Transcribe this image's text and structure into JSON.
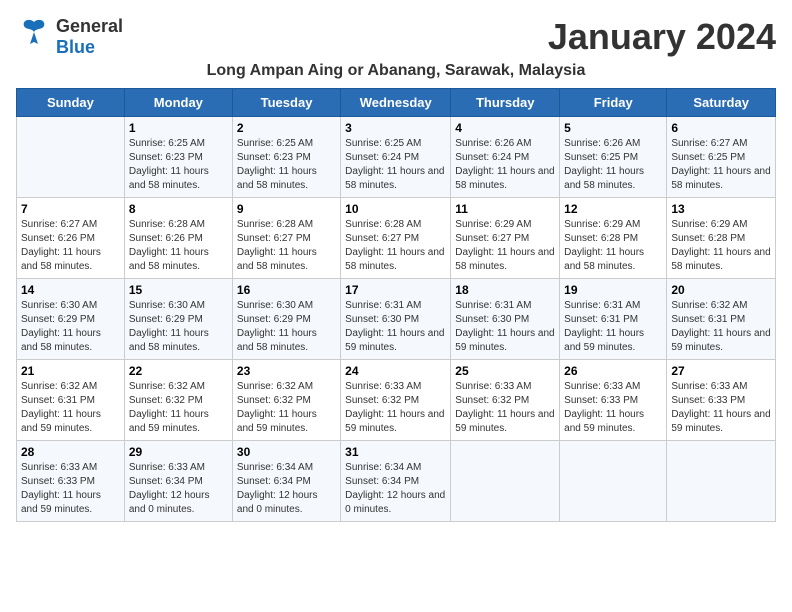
{
  "logo": {
    "general": "General",
    "blue": "Blue"
  },
  "title": "January 2024",
  "subtitle": "Long Ampan Aing or Abanang, Sarawak, Malaysia",
  "days_of_week": [
    "Sunday",
    "Monday",
    "Tuesday",
    "Wednesday",
    "Thursday",
    "Friday",
    "Saturday"
  ],
  "weeks": [
    [
      {
        "day": "",
        "info": ""
      },
      {
        "day": "1",
        "info": "Sunrise: 6:25 AM\nSunset: 6:23 PM\nDaylight: 11 hours and 58 minutes."
      },
      {
        "day": "2",
        "info": "Sunrise: 6:25 AM\nSunset: 6:23 PM\nDaylight: 11 hours and 58 minutes."
      },
      {
        "day": "3",
        "info": "Sunrise: 6:25 AM\nSunset: 6:24 PM\nDaylight: 11 hours and 58 minutes."
      },
      {
        "day": "4",
        "info": "Sunrise: 6:26 AM\nSunset: 6:24 PM\nDaylight: 11 hours and 58 minutes."
      },
      {
        "day": "5",
        "info": "Sunrise: 6:26 AM\nSunset: 6:25 PM\nDaylight: 11 hours and 58 minutes."
      },
      {
        "day": "6",
        "info": "Sunrise: 6:27 AM\nSunset: 6:25 PM\nDaylight: 11 hours and 58 minutes."
      }
    ],
    [
      {
        "day": "7",
        "info": "Sunrise: 6:27 AM\nSunset: 6:26 PM\nDaylight: 11 hours and 58 minutes."
      },
      {
        "day": "8",
        "info": "Sunrise: 6:28 AM\nSunset: 6:26 PM\nDaylight: 11 hours and 58 minutes."
      },
      {
        "day": "9",
        "info": "Sunrise: 6:28 AM\nSunset: 6:27 PM\nDaylight: 11 hours and 58 minutes."
      },
      {
        "day": "10",
        "info": "Sunrise: 6:28 AM\nSunset: 6:27 PM\nDaylight: 11 hours and 58 minutes."
      },
      {
        "day": "11",
        "info": "Sunrise: 6:29 AM\nSunset: 6:27 PM\nDaylight: 11 hours and 58 minutes."
      },
      {
        "day": "12",
        "info": "Sunrise: 6:29 AM\nSunset: 6:28 PM\nDaylight: 11 hours and 58 minutes."
      },
      {
        "day": "13",
        "info": "Sunrise: 6:29 AM\nSunset: 6:28 PM\nDaylight: 11 hours and 58 minutes."
      }
    ],
    [
      {
        "day": "14",
        "info": "Sunrise: 6:30 AM\nSunset: 6:29 PM\nDaylight: 11 hours and 58 minutes."
      },
      {
        "day": "15",
        "info": "Sunrise: 6:30 AM\nSunset: 6:29 PM\nDaylight: 11 hours and 58 minutes."
      },
      {
        "day": "16",
        "info": "Sunrise: 6:30 AM\nSunset: 6:29 PM\nDaylight: 11 hours and 58 minutes."
      },
      {
        "day": "17",
        "info": "Sunrise: 6:31 AM\nSunset: 6:30 PM\nDaylight: 11 hours and 59 minutes."
      },
      {
        "day": "18",
        "info": "Sunrise: 6:31 AM\nSunset: 6:30 PM\nDaylight: 11 hours and 59 minutes."
      },
      {
        "day": "19",
        "info": "Sunrise: 6:31 AM\nSunset: 6:31 PM\nDaylight: 11 hours and 59 minutes."
      },
      {
        "day": "20",
        "info": "Sunrise: 6:32 AM\nSunset: 6:31 PM\nDaylight: 11 hours and 59 minutes."
      }
    ],
    [
      {
        "day": "21",
        "info": "Sunrise: 6:32 AM\nSunset: 6:31 PM\nDaylight: 11 hours and 59 minutes."
      },
      {
        "day": "22",
        "info": "Sunrise: 6:32 AM\nSunset: 6:32 PM\nDaylight: 11 hours and 59 minutes."
      },
      {
        "day": "23",
        "info": "Sunrise: 6:32 AM\nSunset: 6:32 PM\nDaylight: 11 hours and 59 minutes."
      },
      {
        "day": "24",
        "info": "Sunrise: 6:33 AM\nSunset: 6:32 PM\nDaylight: 11 hours and 59 minutes."
      },
      {
        "day": "25",
        "info": "Sunrise: 6:33 AM\nSunset: 6:32 PM\nDaylight: 11 hours and 59 minutes."
      },
      {
        "day": "26",
        "info": "Sunrise: 6:33 AM\nSunset: 6:33 PM\nDaylight: 11 hours and 59 minutes."
      },
      {
        "day": "27",
        "info": "Sunrise: 6:33 AM\nSunset: 6:33 PM\nDaylight: 11 hours and 59 minutes."
      }
    ],
    [
      {
        "day": "28",
        "info": "Sunrise: 6:33 AM\nSunset: 6:33 PM\nDaylight: 11 hours and 59 minutes."
      },
      {
        "day": "29",
        "info": "Sunrise: 6:33 AM\nSunset: 6:34 PM\nDaylight: 12 hours and 0 minutes."
      },
      {
        "day": "30",
        "info": "Sunrise: 6:34 AM\nSunset: 6:34 PM\nDaylight: 12 hours and 0 minutes."
      },
      {
        "day": "31",
        "info": "Sunrise: 6:34 AM\nSunset: 6:34 PM\nDaylight: 12 hours and 0 minutes."
      },
      {
        "day": "",
        "info": ""
      },
      {
        "day": "",
        "info": ""
      },
      {
        "day": "",
        "info": ""
      }
    ]
  ]
}
